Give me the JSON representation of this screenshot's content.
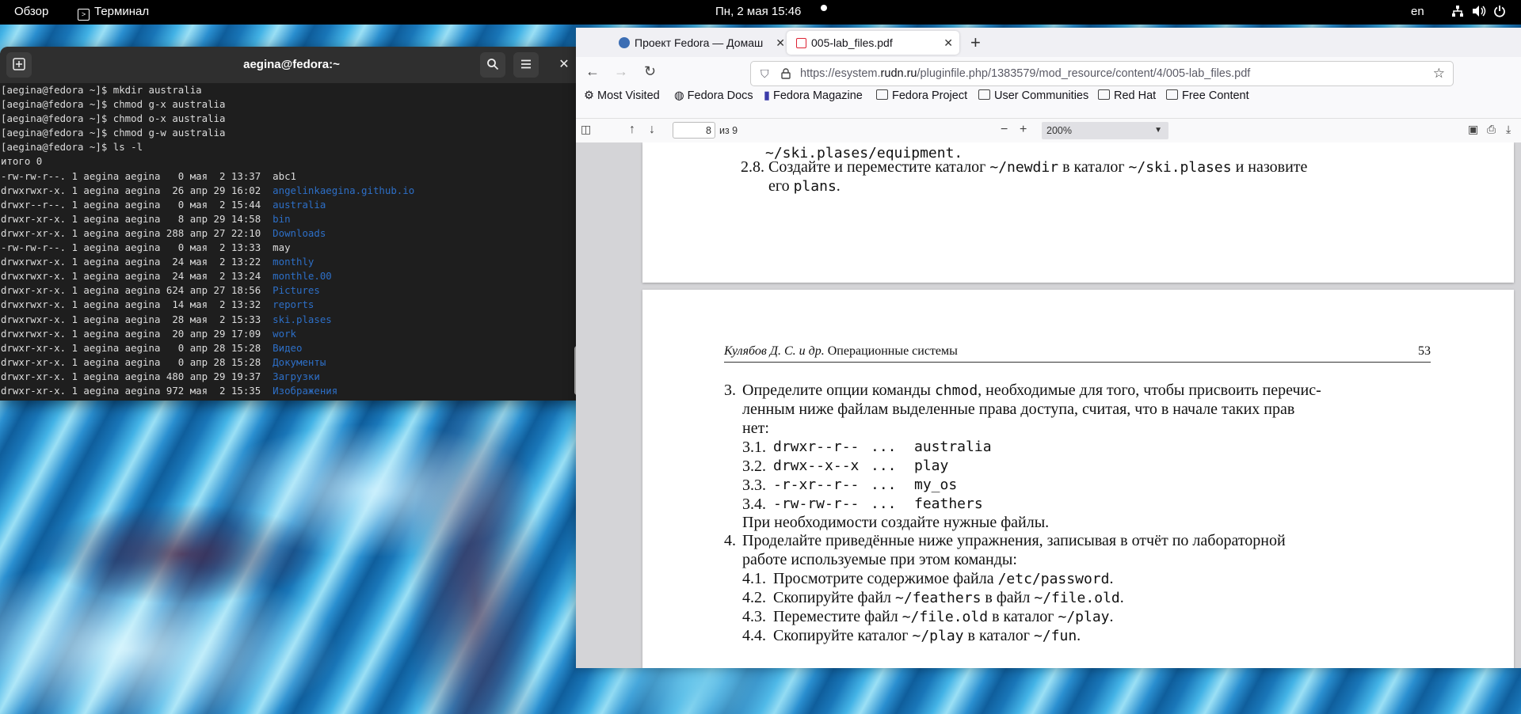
{
  "topbar": {
    "activities": "Обзор",
    "app_name": "Терминал",
    "clock": "Пн, 2 мая  15:46",
    "lang": "en"
  },
  "terminal": {
    "title": "aegina@fedora:~",
    "lines": [
      {
        "text": "[aegina@fedora ~]$ mkdir australia",
        "dir": ""
      },
      {
        "text": "[aegina@fedora ~]$ chmod g-x australia",
        "dir": ""
      },
      {
        "text": "[aegina@fedora ~]$ chmod o-x australia",
        "dir": ""
      },
      {
        "text": "[aegina@fedora ~]$ chmod g-w australia",
        "dir": ""
      },
      {
        "text": "[aegina@fedora ~]$ ls -l",
        "dir": ""
      },
      {
        "text": "итого 0",
        "dir": ""
      },
      {
        "text": "-rw-rw-r--. 1 aegina aegina   0 мая  2 13:37  abc1",
        "dir": ""
      },
      {
        "text": "drwxrwxr-x. 1 aegina aegina  26 апр 29 16:02  ",
        "dir": "angelinkaegina.github.io"
      },
      {
        "text": "drwxr--r--. 1 aegina aegina   0 мая  2 15:44  ",
        "dir": "australia"
      },
      {
        "text": "drwxr-xr-x. 1 aegina aegina   8 апр 29 14:58  ",
        "dir": "bin"
      },
      {
        "text": "drwxr-xr-x. 1 aegina aegina 288 апр 27 22:10  ",
        "dir": "Downloads"
      },
      {
        "text": "-rw-rw-r--. 1 aegina aegina   0 мая  2 13:33  may",
        "dir": ""
      },
      {
        "text": "drwxrwxr-x. 1 aegina aegina  24 мая  2 13:22  ",
        "dir": "monthly"
      },
      {
        "text": "drwxrwxr-x. 1 aegina aegina  24 мая  2 13:24  ",
        "dir": "monthle.00"
      },
      {
        "text": "drwxr-xr-x. 1 aegina aegina 624 апр 27 18:56  ",
        "dir": "Pictures"
      },
      {
        "text": "drwxrwxr-x. 1 aegina aegina  14 мая  2 13:32  ",
        "dir": "reports"
      },
      {
        "text": "drwxrwxr-x. 1 aegina aegina  28 мая  2 15:33  ",
        "dir": "ski.plases"
      },
      {
        "text": "drwxrwxr-x. 1 aegina aegina  20 апр 29 17:09  ",
        "dir": "work"
      },
      {
        "text": "drwxr-xr-x. 1 aegina aegina   0 апр 28 15:28  ",
        "dir": "Видео"
      },
      {
        "text": "drwxr-xr-x. 1 aegina aegina   0 апр 28 15:28  ",
        "dir": "Документы"
      },
      {
        "text": "drwxr-xr-x. 1 aegina aegina 480 апр 29 19:37  ",
        "dir": "Загрузки"
      },
      {
        "text": "drwxr-xr-x. 1 aegina aegina 972 мая  2 15:35  ",
        "dir": "Изображения"
      }
    ]
  },
  "firefox": {
    "tabs": [
      {
        "label": "Проект Fedora — Домаш",
        "active": false
      },
      {
        "label": "005-lab_files.pdf",
        "active": true
      }
    ],
    "url_prefix": "https://esystem.",
    "url_domain": "rudn.ru",
    "url_path": "/pluginfile.php/1383579/mod_resource/content/4/005-lab_files.pdf",
    "bookmarks": [
      "Most Visited",
      "Fedora Docs",
      "Fedora Magazine",
      "Fedora Project",
      "User Communities",
      "Red Hat",
      "Free Content"
    ]
  },
  "pdf": {
    "page_number": "8",
    "page_count": "из 9",
    "zoom": "200%",
    "prev_page": {
      "line1": "~/ski.plases/equipment.",
      "item_num": "2.8.",
      "item_text_a": "Создайте и переместите каталог ",
      "item_code_a": "~/newdir",
      "item_text_b": " в каталог ",
      "item_code_b": "~/ski.plases",
      "item_text_c": " и назовите",
      "item_line2_a": "его ",
      "item_line2_code": "plans",
      "item_line2_b": "."
    },
    "header_left_italic": "Кулябов Д. С. и др.",
    "header_left": " Операционные системы",
    "header_page": "53",
    "item3": {
      "num": "3.",
      "line1_a": "Определите опции команды ",
      "line1_code": "chmod",
      "line1_b": ", необходимые для того, чтобы присвоить перечис-",
      "line2": "ленным ниже файлам выделенные права доступа, считая, что в начале таких прав",
      "line3": "нет:",
      "subitems": [
        {
          "num": "3.1.",
          "perm": "drwxr--r--",
          "dots": "...",
          "name": "australia"
        },
        {
          "num": "3.2.",
          "perm": "drwx--x--x",
          "dots": "...",
          "name": "play"
        },
        {
          "num": "3.3.",
          "perm": "-r-xr--r--",
          "dots": "...",
          "name": "my_os"
        },
        {
          "num": "3.4.",
          "perm": "-rw-rw-r--",
          "dots": "...",
          "name": "feathers"
        }
      ],
      "note": "При необходимости создайте нужные файлы."
    },
    "item4": {
      "num": "4.",
      "line1": "Проделайте приведённые ниже упражнения, записывая в отчёт по лабораторной",
      "line2": "работе используемые при этом команды:",
      "subitems": [
        {
          "num": "4.1.",
          "a": "Просмотрите содержимое файла ",
          "code": "/etc/password",
          "b": ".",
          "code2": "",
          "c": ""
        },
        {
          "num": "4.2.",
          "a": "Скопируйте файл ",
          "code": "~/feathers",
          "b": " в файл ",
          "code2": "~/file.old",
          "c": "."
        },
        {
          "num": "4.3.",
          "a": "Переместите файл ",
          "code": "~/file.old",
          "b": " в каталог ",
          "code2": "~/play",
          "c": "."
        },
        {
          "num": "4.4.",
          "a": "Скопируйте каталог ",
          "code": "~/play",
          "b": " в каталог ",
          "code2": "~/fun",
          "c": "."
        }
      ]
    }
  }
}
